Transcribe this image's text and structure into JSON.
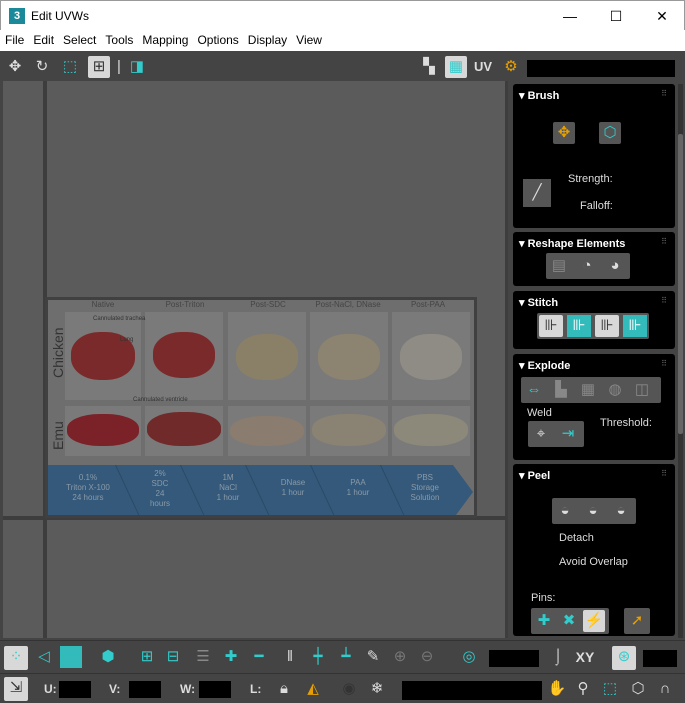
{
  "window": {
    "title": "Edit UVWs",
    "app_icon": "3",
    "minimize": "—",
    "maximize": "☐",
    "close": "✕"
  },
  "menu": [
    "File",
    "Edit",
    "Select",
    "Tools",
    "Mapping",
    "Options",
    "Display",
    "View"
  ],
  "toolbar_top": {
    "uv_label": "UV"
  },
  "texture": {
    "columns": [
      "Native",
      "Post-Triton",
      "Post-SDC",
      "Post-NaCl, DNase",
      "Post-PAA"
    ],
    "rows": [
      "Chicken",
      "Emu"
    ],
    "annotations": [
      "Cannulated trachea",
      "Lung",
      "Cannulated ventricle"
    ],
    "steps": [
      "0.1%\nTriton X-100\n24 hours",
      "2%\nSDC\n24\nhours",
      "1M\nNaCl\n1 hour",
      "DNase\n1 hour",
      "PAA\n1 hour",
      "PBS\nStorage\nSolution"
    ]
  },
  "panel": {
    "brush": {
      "title": "Brush",
      "strength": "Strength:",
      "falloff": "Falloff:"
    },
    "reshape": {
      "title": "Reshape Elements"
    },
    "stitch": {
      "title": "Stitch"
    },
    "explode": {
      "title": "Explode",
      "weld": "Weld",
      "threshold": "Threshold:"
    },
    "peel": {
      "title": "Peel",
      "detach": "Detach",
      "avoid_overlap": "Avoid Overlap",
      "pins": "Pins:"
    }
  },
  "bottom": {
    "xy": "XY",
    "u": "U:",
    "v": "V:",
    "w": "W:",
    "l": "L:"
  }
}
